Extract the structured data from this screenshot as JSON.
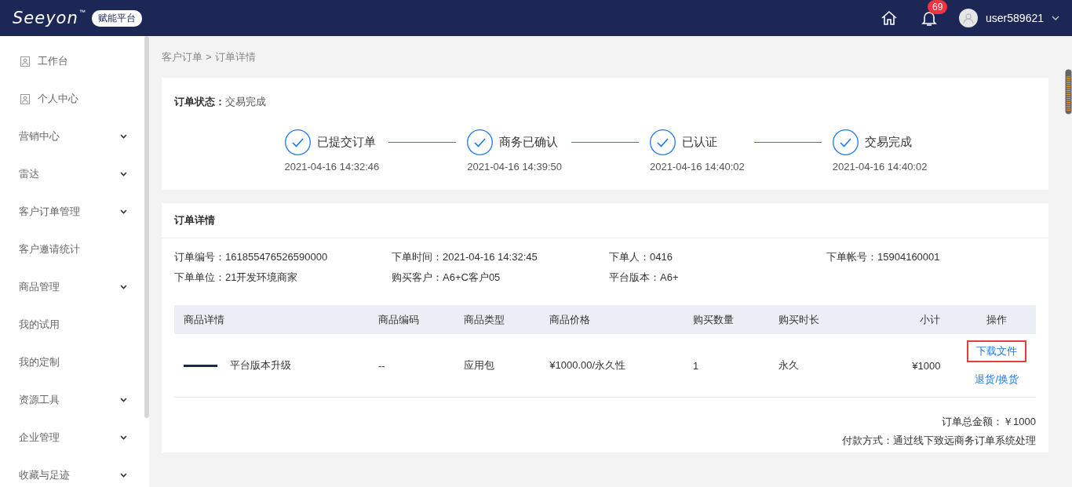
{
  "header": {
    "logo_text": "Seeyon",
    "trademark": "™",
    "badge": "赋能平台",
    "notification_count": "69",
    "username": "user589621"
  },
  "sidebar": {
    "items": [
      {
        "label": "工作台",
        "kind": "page"
      },
      {
        "label": "个人中心",
        "kind": "page"
      },
      {
        "label": "营销中心",
        "kind": "menu",
        "expanded": false
      },
      {
        "label": "雷达",
        "kind": "menu",
        "expanded": false
      },
      {
        "label": "客户订单管理",
        "kind": "menu",
        "expanded": false
      },
      {
        "label": "客户邀请统计",
        "kind": "plain"
      },
      {
        "label": "商品管理",
        "kind": "menu",
        "expanded": false
      },
      {
        "label": "我的试用",
        "kind": "plain"
      },
      {
        "label": "我的定制",
        "kind": "plain"
      },
      {
        "label": "资源工具",
        "kind": "menu",
        "expanded": false
      },
      {
        "label": "企业管理",
        "kind": "menu",
        "expanded": false
      },
      {
        "label": "收藏与足迹",
        "kind": "menu",
        "expanded": false
      }
    ]
  },
  "breadcrumb": [
    "客户订单",
    "订单详情"
  ],
  "breadcrumb_separator": ">",
  "status": {
    "label": "订单状态：",
    "value": "交易完成",
    "steps": [
      {
        "label": "已提交订单",
        "time": "2021-04-16 14:32:46",
        "done": true
      },
      {
        "label": "商务已确认",
        "time": "2021-04-16 14:39:50",
        "done": true
      },
      {
        "label": "已认证",
        "time": "2021-04-16 14:40:02",
        "done": true
      },
      {
        "label": "交易完成",
        "time": "2021-04-16 14:40:02",
        "done": true
      }
    ]
  },
  "details": {
    "title": "订单详情",
    "fields": [
      {
        "label": "订单编号：",
        "value": "161855476526590000"
      },
      {
        "label": "下单时间：",
        "value": "2021-04-16 14:32:45"
      },
      {
        "label": "下单人：",
        "value": "0416"
      },
      {
        "label": "下单帐号：",
        "value": "15904160001"
      },
      {
        "label": "下单单位：",
        "value": "21开发环境商家"
      },
      {
        "label": "购买客户：",
        "value": "A6+C客户05"
      },
      {
        "label": "平台版本：",
        "value": "A6+"
      }
    ],
    "table": {
      "columns": [
        "商品详情",
        "商品编码",
        "商品类型",
        "商品价格",
        "购买数量",
        "购买时长",
        "小计",
        "操作"
      ],
      "rows": [
        {
          "name": "平台版本升级",
          "code": "--",
          "type": "应用包",
          "price": "¥1000.00/永久性",
          "quantity": "1",
          "duration": "永久",
          "subtotal": "¥1000",
          "actions": [
            {
              "label": "下载文件",
              "highlighted": true
            },
            {
              "label": "退货/换货",
              "highlighted": false
            }
          ]
        }
      ]
    },
    "total": "订单总金额：￥1000",
    "payment": "付款方式：通过线下致远商务订单系统处理"
  }
}
